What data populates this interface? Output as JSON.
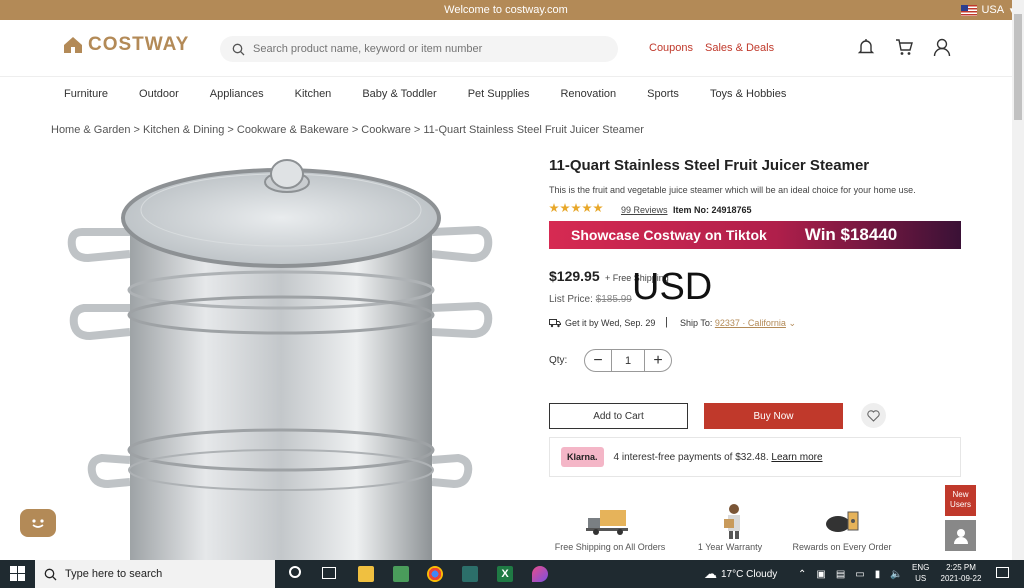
{
  "topbar": {
    "welcome": "Welcome to costway.com",
    "currency": "USA"
  },
  "header": {
    "logo": "COSTWAY",
    "search_placeholder": "Search product name, keyword or item number",
    "coupons": "Coupons",
    "sales": "Sales & Deals"
  },
  "nav": [
    "Furniture",
    "Outdoor",
    "Appliances",
    "Kitchen",
    "Baby & Toddler",
    "Pet Supplies",
    "Renovation",
    "Sports",
    "Toys & Hobbies"
  ],
  "breadcrumb": "Home & Garden > Kitchen & Dining > Cookware & Bakeware > Cookware >  11-Quart Stainless Steel Fruit Juicer Steamer",
  "product": {
    "title": "11-Quart Stainless Steel Fruit Juicer Steamer",
    "description": "This is the fruit and vegetable juice steamer which will be an ideal choice for your home use.",
    "rating": 5,
    "reviews": "99 Reviews",
    "item_no": "Item No: 24918765",
    "banner_left": "Showcase Costway on Tiktok",
    "banner_right": "Win $18440",
    "price": "$129.95",
    "free_shipping": "+ Free Shipping",
    "usd_overlay": "USD",
    "list_price_label": "List Price:",
    "list_price": "$185.99",
    "delivery": "Get it by Wed, Sep. 29",
    "ship_to_label": "Ship To:",
    "ship_to": "92337 · California",
    "qty_label": "Qty:",
    "qty": "1",
    "add_to_cart": "Add to Cart",
    "buy_now": "Buy Now",
    "klarna_logo": "Klarna.",
    "klarna_text": "4 interest-free payments of $32.48.",
    "klarna_link": "Learn more",
    "features": [
      "Free Shipping on All Orders",
      "1 Year Warranty",
      "Rewards on Every Order"
    ]
  },
  "side": {
    "new_users": "New Users"
  },
  "taskbar": {
    "search": "Type here to search",
    "weather": "17°C  Cloudy",
    "lang1": "ENG",
    "lang2": "US",
    "time": "2:25 PM",
    "date": "2021-09-22"
  }
}
